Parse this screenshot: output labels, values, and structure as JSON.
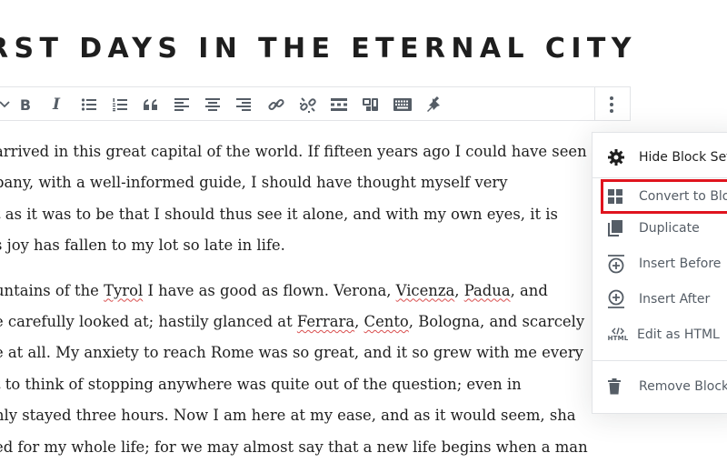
{
  "title": "RST DAYS IN THE ETERNAL CITY",
  "toolbar": {
    "buttons": [
      "bold-button",
      "italic-button",
      "bullet-list-button",
      "numbered-list-button",
      "quote-button",
      "align-left-button",
      "align-center-button",
      "align-right-button",
      "link-button",
      "unlink-button",
      "read-more-button",
      "embed-button",
      "keyboard-button",
      "pin-button"
    ],
    "bold_label": "B",
    "italic_label": "I"
  },
  "content": {
    "paragraph1": [
      "arrived in this great capital of the world. If fifteen years ago I could have seen",
      "pany, with a well-informed guide, I should have thought myself very",
      "t as it was to be that I should thus see it alone, and with my own eyes, it is",
      "s joy has fallen to my lot so late in life."
    ],
    "paragraph2": {
      "l1_a": "untains of the ",
      "l1_b": "Tyrol",
      "l1_c": " I have as good as flown. Verona, ",
      "l1_d": "Vicenza",
      "l1_e": ", ",
      "l1_f": "Padua",
      "l1_g": ", and",
      "l2_a": "e carefully looked at; hastily glanced at ",
      "l2_b": "Ferrara",
      "l2_c": ", ",
      "l2_d": "Cento",
      "l2_e": ", Bologna, and scarcely",
      "l3": "e at all. My anxiety to reach Rome was so great, and it so grew with me every",
      "l4": "t to think of stopping anywhere was quite out of the question; even in",
      "l5": "nly stayed three hours. Now I am here at my ease, and as it would seem, sha",
      "l6": "ed for my whole life; for we may almost say that a new life begins when a man"
    }
  },
  "menu": {
    "hide_settings": "Hide Block Setti",
    "convert": "Convert to Block",
    "duplicate": "Duplicate",
    "insert_before": "Insert Before",
    "insert_after": "Insert After",
    "edit_html": "Edit as HTML",
    "html_badge": "HTML",
    "remove": "Remove Block"
  },
  "colors": {
    "highlight": "#e0141e",
    "text": "#1e1e1e",
    "menu_text": "#555d66",
    "border": "#e2e4e7"
  }
}
